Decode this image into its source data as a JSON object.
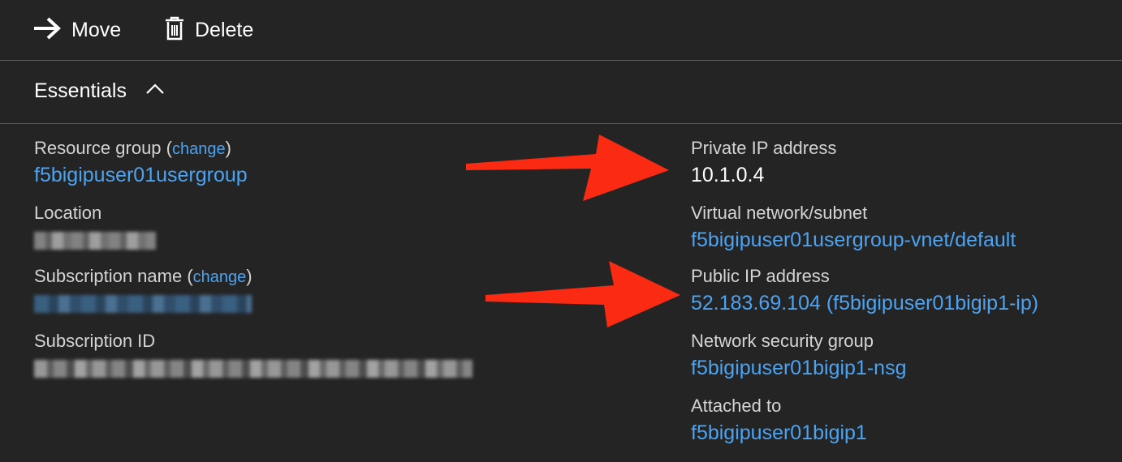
{
  "toolbar": {
    "move_label": "Move",
    "delete_label": "Delete",
    "move_icon": "arrow-right-icon",
    "delete_icon": "trash-icon"
  },
  "essentials": {
    "title": "Essentials",
    "toggle_icon": "chevron-up-icon"
  },
  "left": {
    "resource_group": {
      "label": "Resource group",
      "open": "(",
      "change": "change",
      "close": ")",
      "value": "f5bigipuser01usergroup"
    },
    "location": {
      "label": "Location"
    },
    "subscription_name": {
      "label": "Subscription name",
      "open": "(",
      "change": "change",
      "close": ")"
    },
    "subscription_id": {
      "label": "Subscription ID"
    }
  },
  "right": {
    "private_ip": {
      "label": "Private IP address",
      "value": "10.1.0.4"
    },
    "vnet": {
      "label": "Virtual network/subnet",
      "value": "f5bigipuser01usergroup-vnet/default"
    },
    "public_ip": {
      "label": "Public IP address",
      "value": "52.183.69.104 (f5bigipuser01bigip1-ip)"
    },
    "nsg": {
      "label": "Network security group",
      "value": "f5bigipuser01bigip1-nsg"
    },
    "attached": {
      "label": "Attached to",
      "value": "f5bigipuser01bigip1"
    }
  },
  "colors": {
    "background": "#242424",
    "link": "#4ba3f2",
    "annotation_arrow": "#fa2b12"
  }
}
